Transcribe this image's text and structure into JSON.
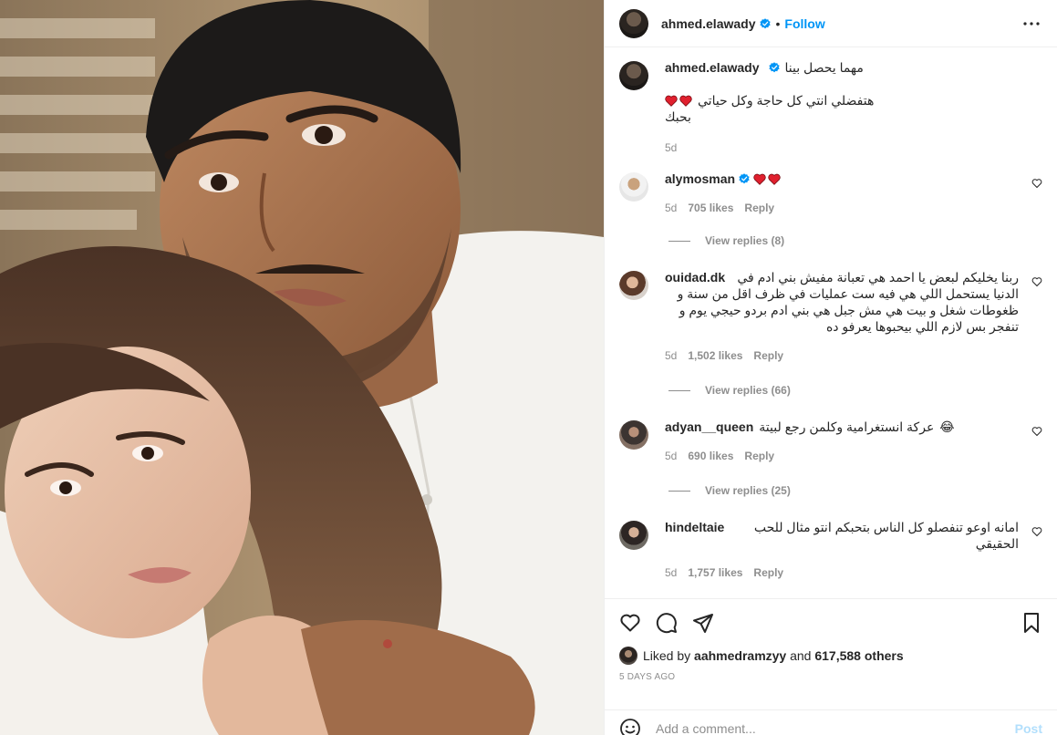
{
  "post": {
    "author": "ahmed.elawady",
    "follow_label": "Follow",
    "separator": "•",
    "image_alt": "selfie photo",
    "caption": {
      "line1": "مهما يحصل بينا",
      "line2": "هتفضلي انتي كل حاجة وكل حياتي",
      "line3": "بحبك",
      "time": "5d"
    }
  },
  "comments": [
    {
      "username": "alymosman",
      "verified": true,
      "text": "",
      "time": "5d",
      "likes": "705 likes",
      "reply_label": "Reply",
      "view_replies": "View replies (8)"
    },
    {
      "username": "ouidad.dk",
      "verified": false,
      "text": "ربنا يخليكم لبعض يا احمد هي تعبانة مفيش بني ادم في الدنيا يستحمل اللي هي فيه ست عمليات في ظرف اقل من سنة و ظغوطات شغل و بيت هي مش جبل هي بني ادم بردو حيجي يوم و تنفجر بس لازم اللي بيحبوها يعرفو ده",
      "time": "5d",
      "likes": "1,502 likes",
      "reply_label": "Reply",
      "view_replies": "View replies (66)"
    },
    {
      "username": "adyan__queen",
      "verified": false,
      "text": "عركة انستغرامية وكلمن رجع لبيتة",
      "emoji": "😂",
      "time": "5d",
      "likes": "690 likes",
      "reply_label": "Reply",
      "view_replies": "View replies (25)"
    },
    {
      "username": "hindeltaie",
      "verified": false,
      "text": "امانه اوعو تنفصلو كل الناس بتحبكم انتو مثال للحب الحقيقي",
      "time": "5d",
      "likes": "1,757 likes",
      "reply_label": "Reply"
    }
  ],
  "likes_summary": {
    "prefix": "Liked by",
    "user": "aahmedramzyy",
    "connector": "and",
    "others": "617,588 others"
  },
  "date_label": "5 days ago",
  "add_comment": {
    "placeholder": "Add a comment...",
    "post_label": "Post"
  },
  "colors": {
    "accent": "#0095f6",
    "muted": "#8e8e8e",
    "heart": "#ed4956",
    "post_disabled": "#b2dffc"
  },
  "icons": [
    "more-icon",
    "verified-icon",
    "heart-icon",
    "comment-icon",
    "share-icon",
    "bookmark-icon",
    "emoji-icon"
  ]
}
